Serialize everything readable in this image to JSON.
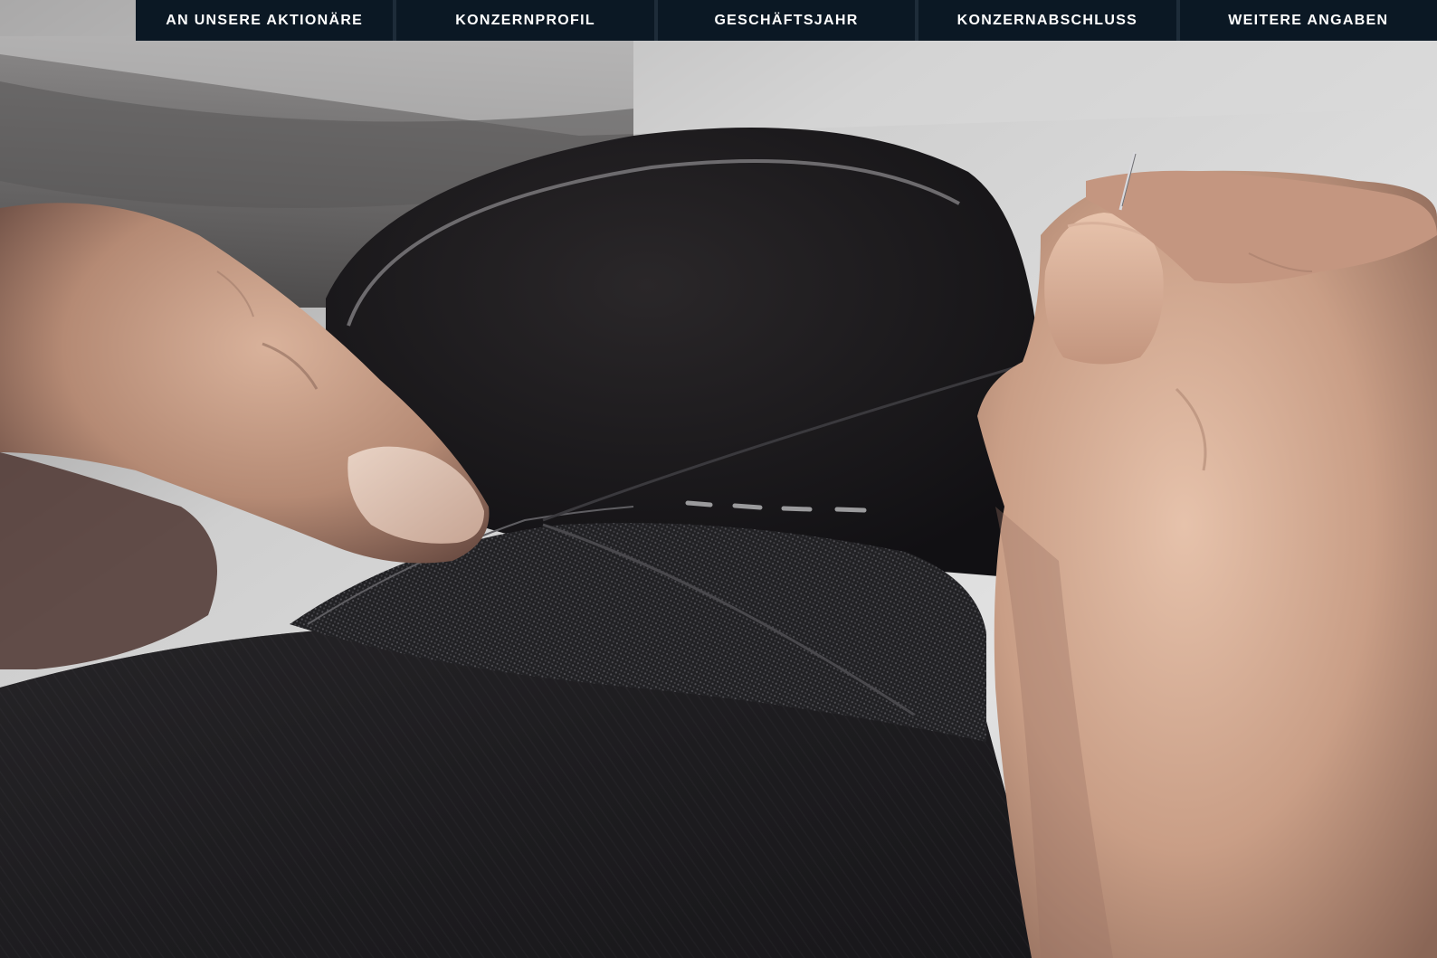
{
  "nav": {
    "items": [
      {
        "label": "AN UNSERE AKTIONÄRE"
      },
      {
        "label": "KONZERNPROFIL"
      },
      {
        "label": "GESCHÄFTSJAHR"
      },
      {
        "label": "KONZERNABSCHLUSS"
      },
      {
        "label": "WEITERE ANGABEN"
      }
    ]
  },
  "colors": {
    "nav_background": "#0b1824",
    "nav_text": "#ffffff",
    "fabric_dark": "#1b1a1d",
    "skin": "#c99e86"
  },
  "hero_image": {
    "icon": "hand-stitching-photo"
  }
}
